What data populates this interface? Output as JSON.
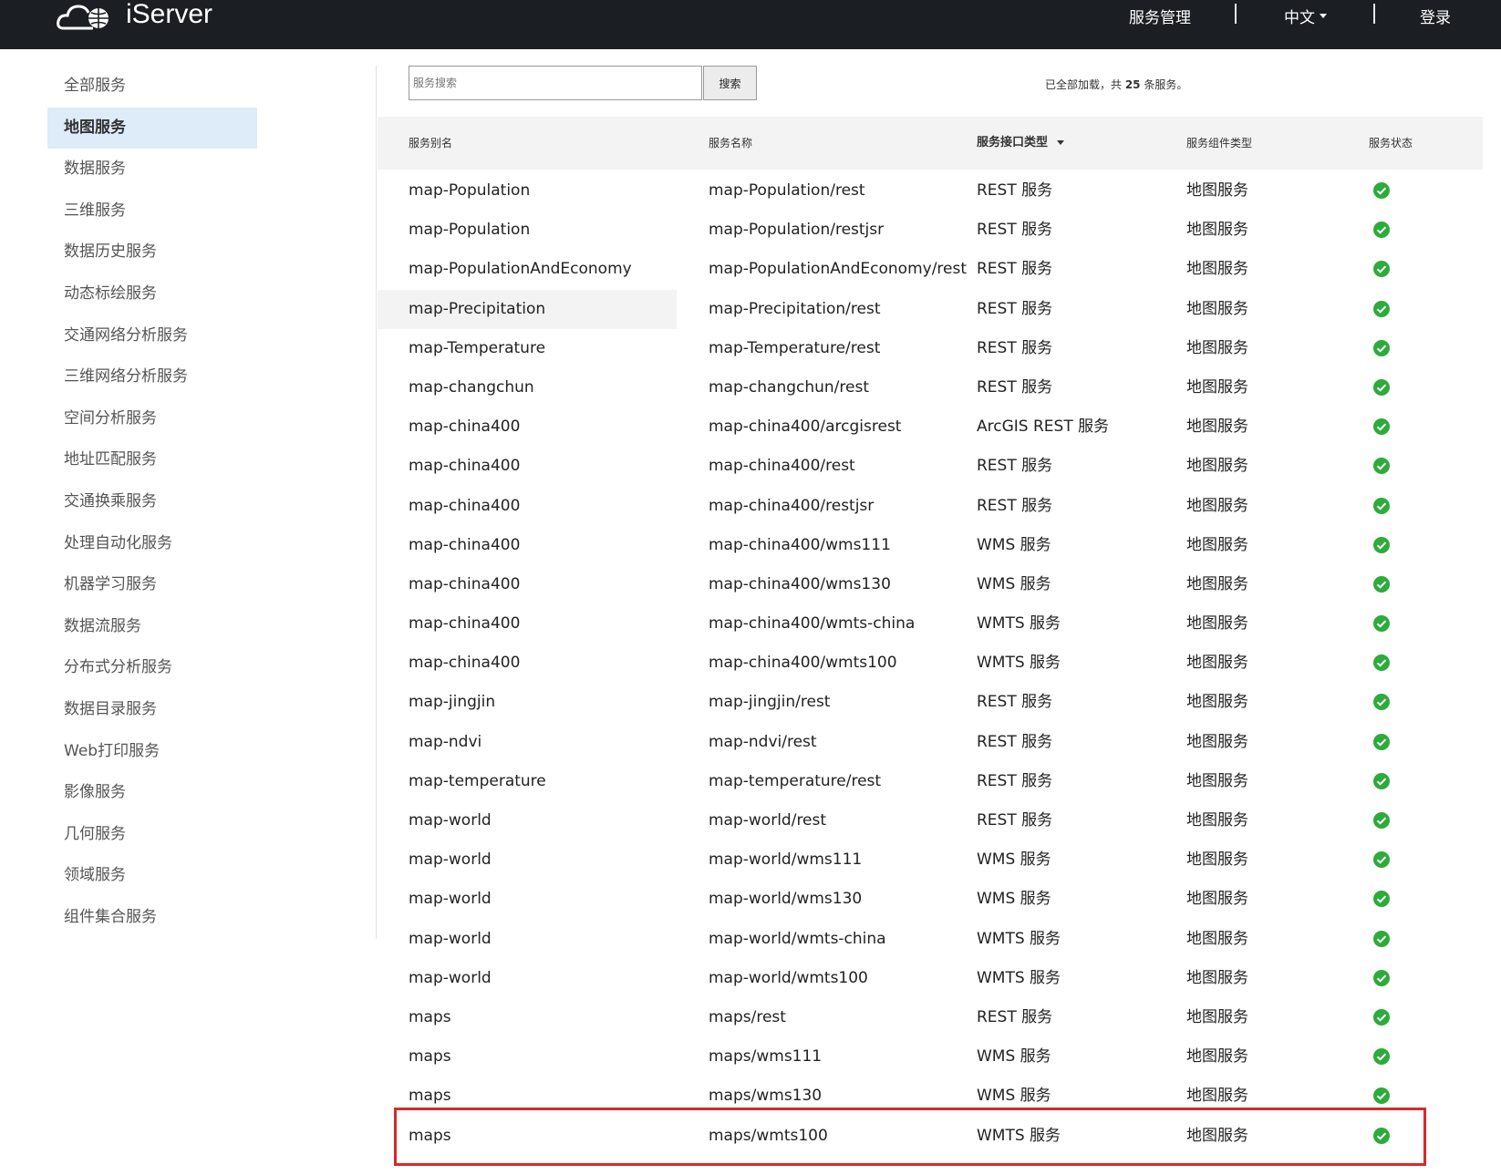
{
  "header": {
    "logo_text": "iServer",
    "nav": {
      "service_manage": "服务管理",
      "language": "中文",
      "login": "登录"
    }
  },
  "sidebar": {
    "items": [
      {
        "label": "全部服务",
        "active": false
      },
      {
        "label": "地图服务",
        "active": true
      },
      {
        "label": "数据服务",
        "active": false
      },
      {
        "label": "三维服务",
        "active": false
      },
      {
        "label": "数据历史服务",
        "active": false
      },
      {
        "label": "动态标绘服务",
        "active": false
      },
      {
        "label": "交通网络分析服务",
        "active": false
      },
      {
        "label": "三维网络分析服务",
        "active": false
      },
      {
        "label": "空间分析服务",
        "active": false
      },
      {
        "label": "地址匹配服务",
        "active": false
      },
      {
        "label": "交通换乘服务",
        "active": false
      },
      {
        "label": "处理自动化服务",
        "active": false
      },
      {
        "label": "机器学习服务",
        "active": false
      },
      {
        "label": "数据流服务",
        "active": false
      },
      {
        "label": "分布式分析服务",
        "active": false
      },
      {
        "label": "数据目录服务",
        "active": false
      },
      {
        "label": "Web打印服务",
        "active": false
      },
      {
        "label": "影像服务",
        "active": false
      },
      {
        "label": "几何服务",
        "active": false
      },
      {
        "label": "领域服务",
        "active": false
      },
      {
        "label": "组件集合服务",
        "active": false
      }
    ]
  },
  "search": {
    "placeholder": "服务搜索",
    "button_label": "搜索"
  },
  "summary": {
    "prefix": "已全部加载，共 ",
    "count": "25",
    "suffix": " 条服务。"
  },
  "table": {
    "headers": {
      "alias": "服务别名",
      "name": "服务名称",
      "interface_type": "服务接口类型",
      "component_type": "服务组件类型",
      "status": "服务状态"
    },
    "rows": [
      {
        "alias": "map-Population",
        "name": "map-Population/rest",
        "interface_type": "REST 服务",
        "component_type": "地图服务",
        "status": "ok"
      },
      {
        "alias": "map-Population",
        "name": "map-Population/restjsr",
        "interface_type": "REST 服务",
        "component_type": "地图服务",
        "status": "ok"
      },
      {
        "alias": "map-PopulationAndEconomy",
        "name": "map-PopulationAndEconomy/rest",
        "interface_type": "REST 服务",
        "component_type": "地图服务",
        "status": "ok"
      },
      {
        "alias": "map-Precipitation",
        "name": "map-Precipitation/rest",
        "interface_type": "REST 服务",
        "component_type": "地图服务",
        "status": "ok",
        "hover": true
      },
      {
        "alias": "map-Temperature",
        "name": "map-Temperature/rest",
        "interface_type": "REST 服务",
        "component_type": "地图服务",
        "status": "ok"
      },
      {
        "alias": "map-changchun",
        "name": "map-changchun/rest",
        "interface_type": "REST 服务",
        "component_type": "地图服务",
        "status": "ok"
      },
      {
        "alias": "map-china400",
        "name": "map-china400/arcgisrest",
        "interface_type": "ArcGIS REST 服务",
        "component_type": "地图服务",
        "status": "ok"
      },
      {
        "alias": "map-china400",
        "name": "map-china400/rest",
        "interface_type": "REST 服务",
        "component_type": "地图服务",
        "status": "ok"
      },
      {
        "alias": "map-china400",
        "name": "map-china400/restjsr",
        "interface_type": "REST 服务",
        "component_type": "地图服务",
        "status": "ok"
      },
      {
        "alias": "map-china400",
        "name": "map-china400/wms111",
        "interface_type": "WMS 服务",
        "component_type": "地图服务",
        "status": "ok"
      },
      {
        "alias": "map-china400",
        "name": "map-china400/wms130",
        "interface_type": "WMS 服务",
        "component_type": "地图服务",
        "status": "ok"
      },
      {
        "alias": "map-china400",
        "name": "map-china400/wmts-china",
        "interface_type": "WMTS 服务",
        "component_type": "地图服务",
        "status": "ok"
      },
      {
        "alias": "map-china400",
        "name": "map-china400/wmts100",
        "interface_type": "WMTS 服务",
        "component_type": "地图服务",
        "status": "ok"
      },
      {
        "alias": "map-jingjin",
        "name": "map-jingjin/rest",
        "interface_type": "REST 服务",
        "component_type": "地图服务",
        "status": "ok"
      },
      {
        "alias": "map-ndvi",
        "name": "map-ndvi/rest",
        "interface_type": "REST 服务",
        "component_type": "地图服务",
        "status": "ok"
      },
      {
        "alias": "map-temperature",
        "name": "map-temperature/rest",
        "interface_type": "REST 服务",
        "component_type": "地图服务",
        "status": "ok"
      },
      {
        "alias": "map-world",
        "name": "map-world/rest",
        "interface_type": "REST 服务",
        "component_type": "地图服务",
        "status": "ok"
      },
      {
        "alias": "map-world",
        "name": "map-world/wms111",
        "interface_type": "WMS 服务",
        "component_type": "地图服务",
        "status": "ok"
      },
      {
        "alias": "map-world",
        "name": "map-world/wms130",
        "interface_type": "WMS 服务",
        "component_type": "地图服务",
        "status": "ok"
      },
      {
        "alias": "map-world",
        "name": "map-world/wmts-china",
        "interface_type": "WMTS 服务",
        "component_type": "地图服务",
        "status": "ok"
      },
      {
        "alias": "map-world",
        "name": "map-world/wmts100",
        "interface_type": "WMTS 服务",
        "component_type": "地图服务",
        "status": "ok"
      },
      {
        "alias": "maps",
        "name": "maps/rest",
        "interface_type": "REST 服务",
        "component_type": "地图服务",
        "status": "ok"
      },
      {
        "alias": "maps",
        "name": "maps/wms111",
        "interface_type": "WMS 服务",
        "component_type": "地图服务",
        "status": "ok"
      },
      {
        "alias": "maps",
        "name": "maps/wms130",
        "interface_type": "WMS 服务",
        "component_type": "地图服务",
        "status": "ok"
      },
      {
        "alias": "maps",
        "name": "maps/wmts100",
        "interface_type": "WMTS 服务",
        "component_type": "地图服务",
        "status": "ok",
        "highlighted": true
      }
    ]
  },
  "colors": {
    "topbar": "#1b1f24",
    "active_sidebar": "#deebf8",
    "status_ok": "#2dab3b",
    "highlight_box": "#d62a2a"
  },
  "icons": {
    "logo": "cloud-globe-logo-icon",
    "status": "check-circle-icon"
  }
}
